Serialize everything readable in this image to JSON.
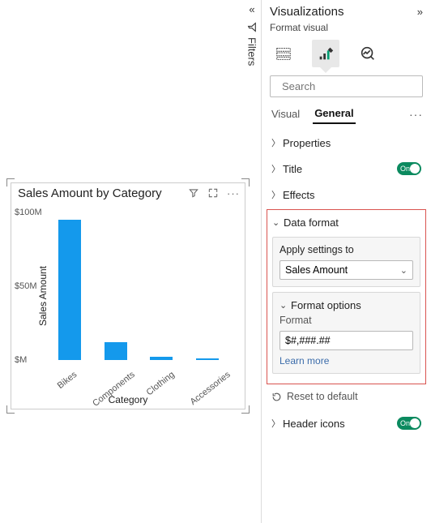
{
  "filters_label": "Filters",
  "visual": {
    "title": "Sales Amount by Category",
    "ylabel": "Sales Amount",
    "xlabel": "Category",
    "yticks": [
      "$100M",
      "$50M",
      "$M"
    ]
  },
  "chart_data": {
    "type": "bar",
    "title": "Sales Amount by Category",
    "xlabel": "Category",
    "ylabel": "Sales Amount",
    "categories": [
      "Bikes",
      "Components",
      "Clothing",
      "Accessories"
    ],
    "values": [
      95,
      12,
      2,
      1
    ],
    "ylim": [
      0,
      100
    ],
    "y_ticks": [
      0,
      50,
      100
    ],
    "y_tick_labels": [
      "$M",
      "$50M",
      "$100M"
    ],
    "value_units": "millions USD"
  },
  "pane": {
    "title": "Visualizations",
    "subtitle": "Format visual",
    "search_placeholder": "Search",
    "tabs": {
      "visual": "Visual",
      "general": "General"
    },
    "sections": {
      "properties": "Properties",
      "title": "Title",
      "effects": "Effects",
      "data_format": "Data format",
      "header_icons": "Header icons"
    },
    "toggle_on": "On",
    "apply_label": "Apply settings to",
    "apply_value": "Sales Amount",
    "format_options": "Format options",
    "format_label": "Format",
    "format_value": "$#,###.##",
    "learn_more": "Learn more",
    "reset": "Reset to default"
  }
}
